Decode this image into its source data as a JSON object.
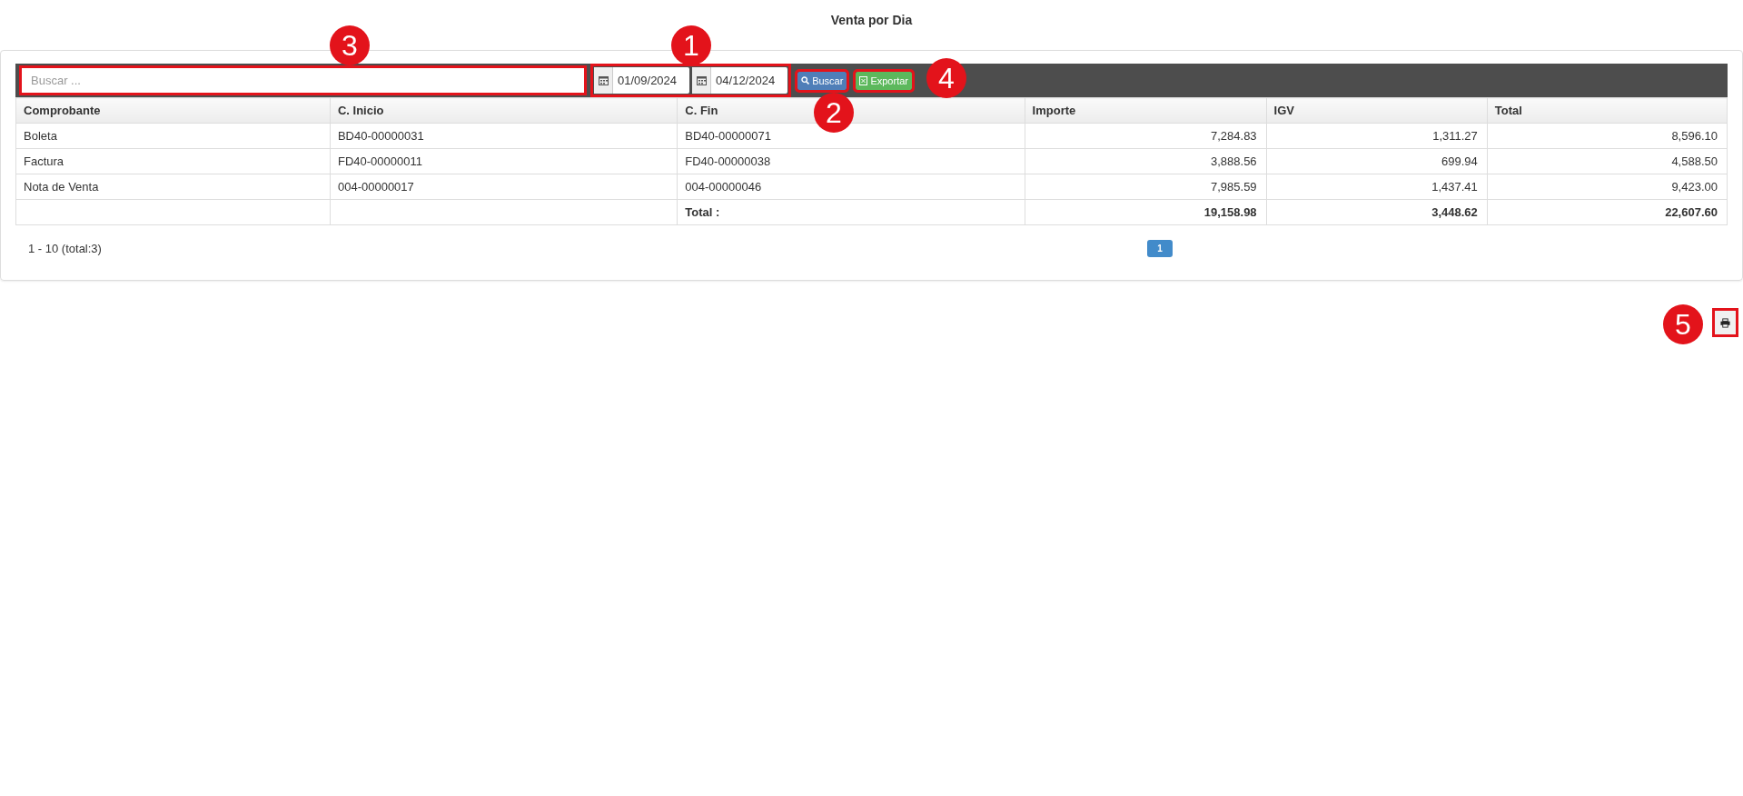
{
  "title": "Venta por Dia",
  "toolbar": {
    "search": {
      "placeholder": "Buscar ...",
      "highlighted": true
    },
    "dates": [
      {
        "value": "01/09/2024"
      },
      {
        "value": "04/12/2024"
      }
    ],
    "dates_highlighted": true,
    "buttons": [
      {
        "kind": "search",
        "label": "Buscar",
        "highlighted": true
      },
      {
        "kind": "export",
        "label": "Exportar",
        "highlighted": true
      }
    ]
  },
  "table": {
    "columns": [
      "Comprobante",
      "C. Inicio",
      "C. Fin",
      "Importe",
      "IGV",
      "Total"
    ],
    "rows": [
      [
        "Boleta",
        "BD40-00000031",
        "BD40-00000071",
        "7,284.83",
        "1,311.27",
        "8,596.10"
      ],
      [
        "Factura",
        "FD40-00000011",
        "FD40-00000038",
        "3,888.56",
        "699.94",
        "4,588.50"
      ],
      [
        "Nota de Venta",
        "004-00000017",
        "004-00000046",
        "7,985.59",
        "1,437.41",
        "9,423.00"
      ]
    ],
    "total_row": {
      "label": "Total :",
      "values": [
        "19,158.98",
        "3,448.62",
        "22,607.60"
      ]
    }
  },
  "pagination": {
    "summary": "1 - 10 (total:3)",
    "pages": [
      {
        "label": "1",
        "selected": true
      }
    ]
  },
  "print_button": {
    "highlighted": true
  },
  "annotations": [
    "3",
    "1",
    "2",
    "4",
    "5"
  ]
}
